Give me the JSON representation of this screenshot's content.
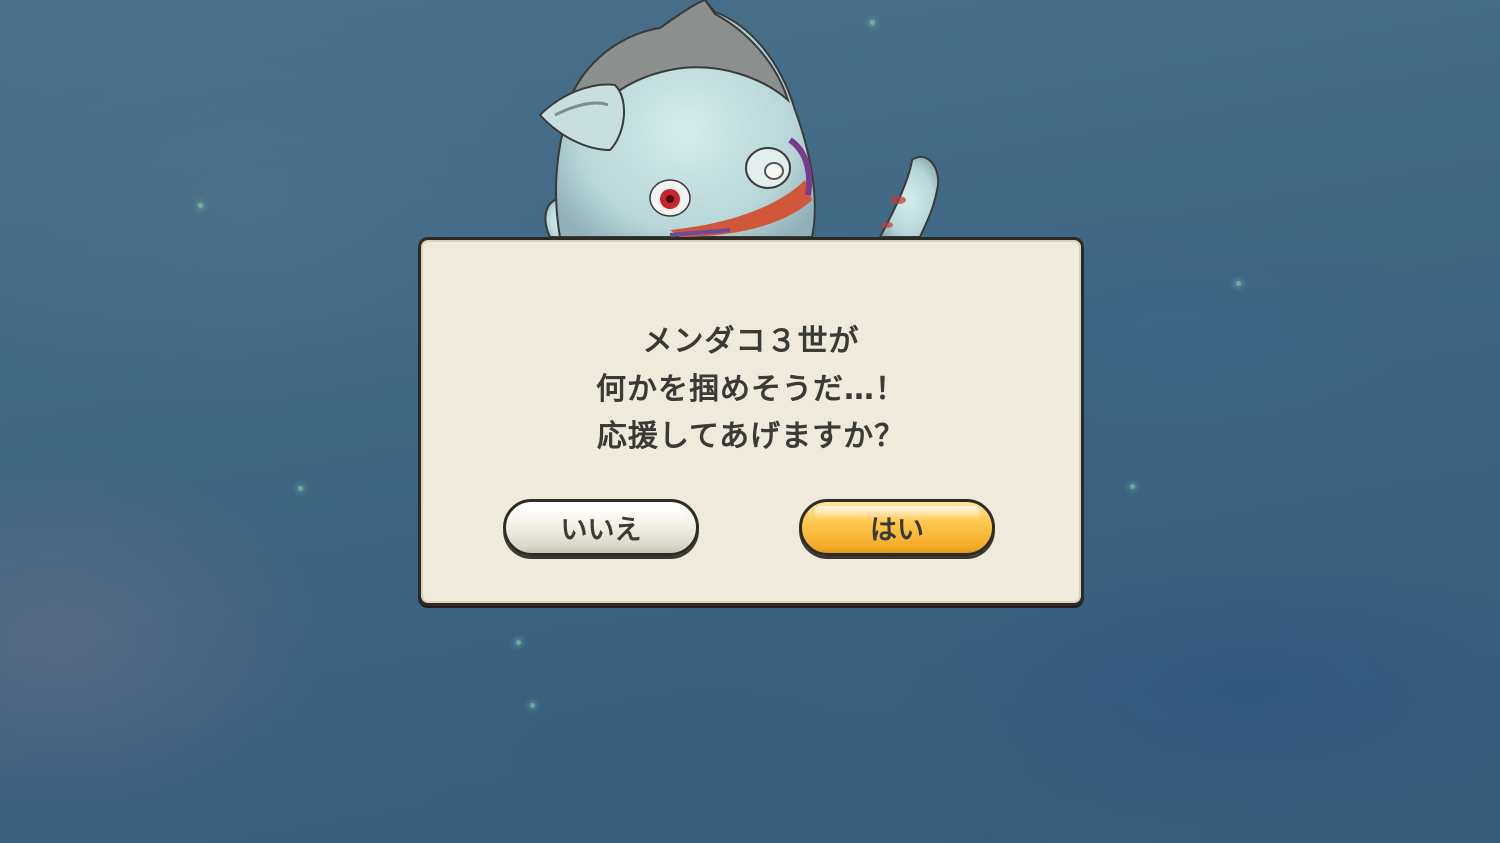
{
  "dialog": {
    "message_lines": [
      "メンダコ３世が",
      "何かを掴めそうだ…！",
      "応援してあげますか？"
    ],
    "no_label": "いいえ",
    "yes_label": "はい"
  },
  "scene": {
    "background": "underwater-night",
    "character": "white-creature-with-red-eye",
    "colors": {
      "water": "#3f6680",
      "dialog_bg": "#efeadb",
      "yes_button": "#ffc84e",
      "no_button": "#f6f3ea",
      "text": "#3a3a37"
    }
  }
}
